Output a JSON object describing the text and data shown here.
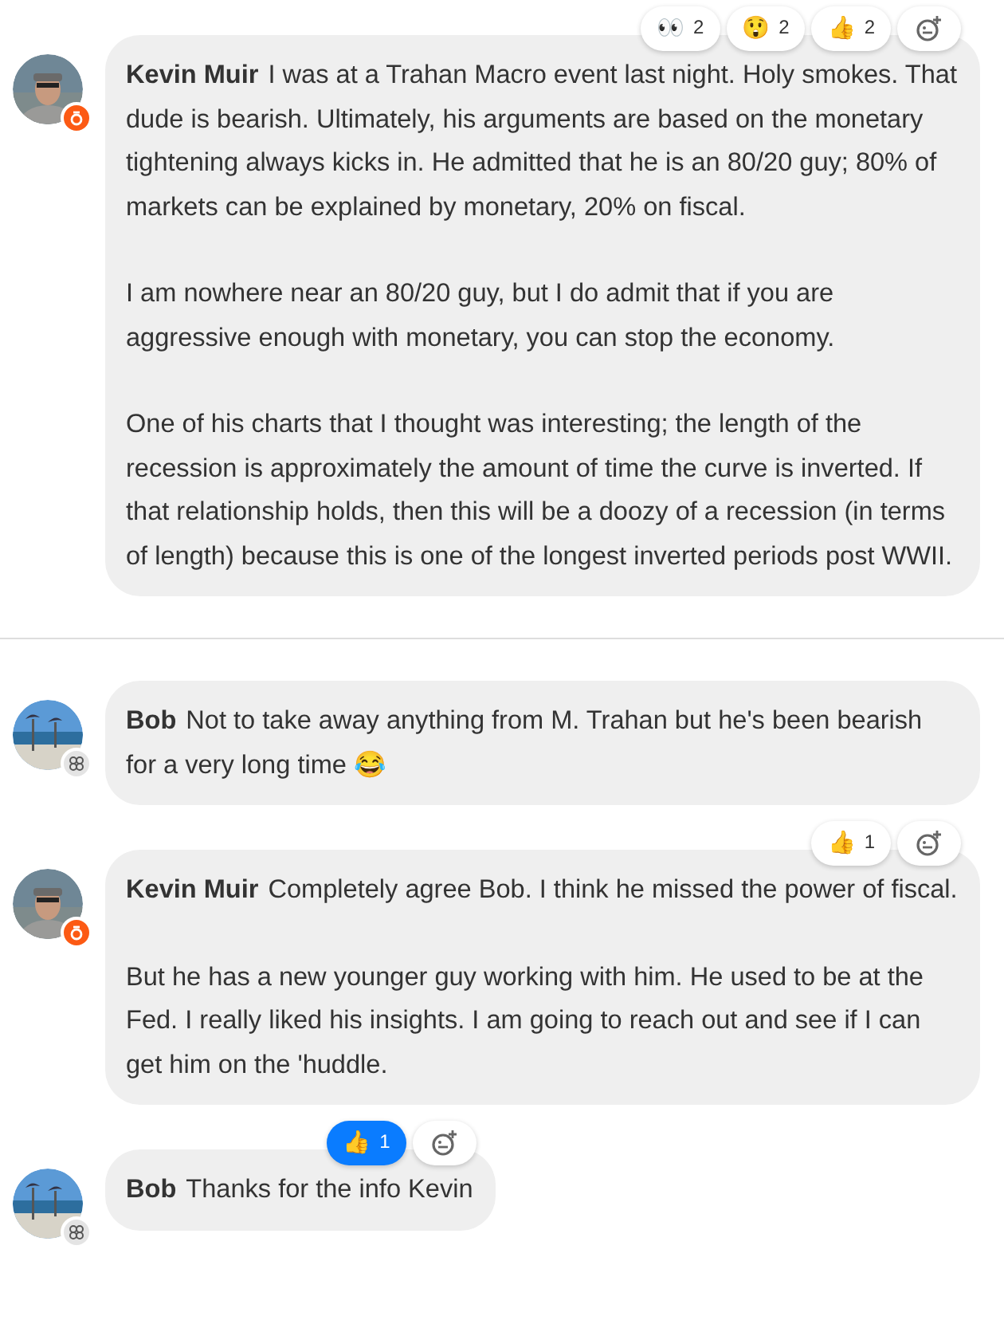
{
  "messages": [
    {
      "author": "Kevin Muir",
      "avatar": {
        "kind": "person",
        "badge": {
          "kind": "pen",
          "color": "#fc5a14"
        }
      },
      "paragraphs": [
        "I was at a Trahan Macro event last night. Holy smokes. That dude is bearish. Ultimately, his arguments are based on the monetary tightening always kicks in. He admitted that he is an 80/20 guy; 80% of markets can be explained by monetary, 20% on fiscal.",
        "I am nowhere near an 80/20 guy, but I do admit that if you are aggressive enough with monetary, you can stop the economy.",
        "One of his charts that I thought was interesting; the length of the recession is approximately the amount of time the curve is inverted. If that relationship holds, then this will be a doozy of a recession (in terms of length) because this is one of the longest inverted periods post WWII."
      ],
      "reactions": [
        {
          "emoji": "👀",
          "count": "2",
          "selected": false
        },
        {
          "emoji": "😲",
          "count": "2",
          "selected": false
        },
        {
          "emoji": "👍",
          "count": "2",
          "selected": false
        }
      ],
      "divider_after": true
    },
    {
      "author": "Bob",
      "avatar": {
        "kind": "beach",
        "badge": {
          "kind": "group",
          "color": "#e4e4e4"
        }
      },
      "paragraphs": [
        "Not to take away anything from M. Trahan but he's been bearish for a very long time 😂"
      ],
      "divider_after": false
    },
    {
      "author": "Kevin Muir",
      "avatar": {
        "kind": "person",
        "badge": {
          "kind": "pen",
          "color": "#fc5a14"
        }
      },
      "paragraphs": [
        "Completely agree Bob. I think he missed the power of fiscal.",
        "But he has a new younger guy working with him. He used to be at the Fed. I really liked his insights. I am going to reach out and see if I can get him on the 'huddle."
      ],
      "reactions": [
        {
          "emoji": "👍",
          "count": "1",
          "selected": false
        }
      ],
      "divider_after": false
    },
    {
      "author": "Bob",
      "avatar": {
        "kind": "beach",
        "badge": {
          "kind": "group",
          "color": "#e4e4e4"
        }
      },
      "paragraphs": [
        "Thanks for the info Kevin"
      ],
      "reactions": [
        {
          "emoji": "👍",
          "count": "1",
          "selected": true
        }
      ],
      "divider_after": false
    }
  ]
}
